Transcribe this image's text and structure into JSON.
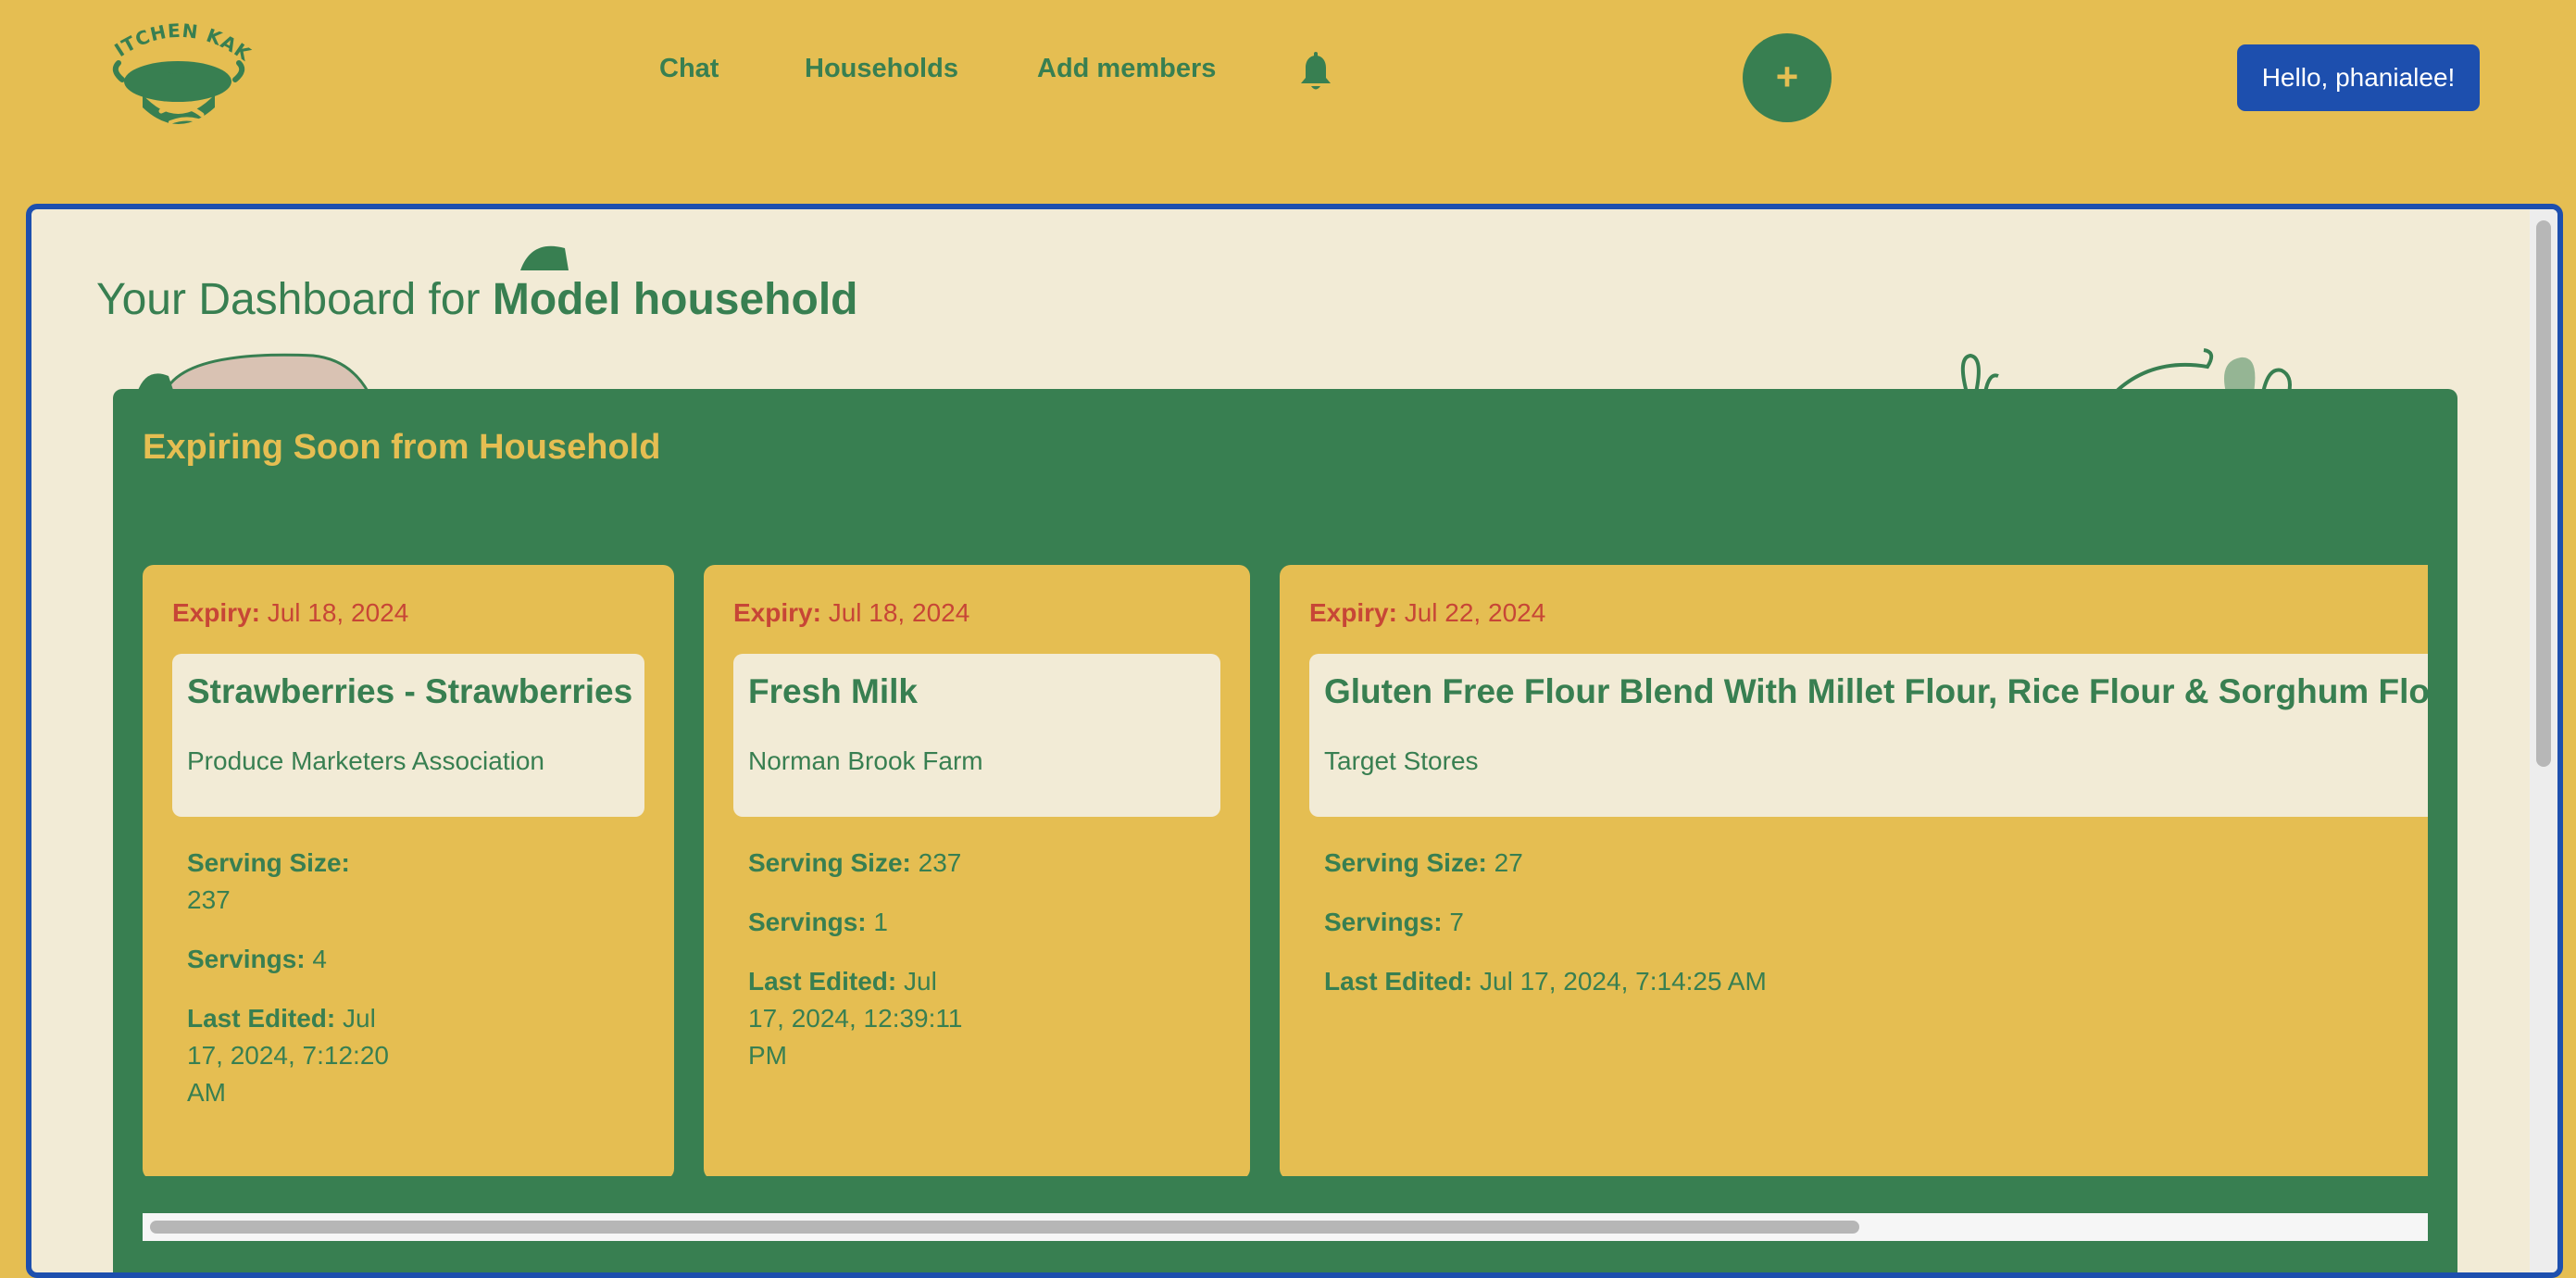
{
  "header": {
    "logo_text": "KITCHEN KAKI",
    "nav": {
      "chat": "Chat",
      "households": "Households",
      "add_members": "Add members"
    },
    "bell_icon": "bell-icon",
    "add_button_label": "+",
    "greeting": "Hello, phanialee!"
  },
  "dashboard": {
    "title_prefix": "Your Dashboard for ",
    "household_name": "Model household"
  },
  "expiring": {
    "title": "Expiring Soon from Household",
    "labels": {
      "expiry": "Expiry:",
      "serving_size": "Serving Size:",
      "servings": "Servings:",
      "last_edited": "Last Edited:"
    },
    "items": [
      {
        "expiry": "Jul 18, 2024",
        "name": "Strawberries - Strawberries",
        "brand": "Produce Marketers Association",
        "serving_size": "237",
        "servings": "4",
        "last_edited": "Jul 17, 2024, 7:12:20 AM"
      },
      {
        "expiry": "Jul 18, 2024",
        "name": "Fresh Milk",
        "brand": "Norman Brook Farm",
        "serving_size": "237",
        "servings": "1",
        "last_edited": "Jul 17, 2024, 12:39:11 PM"
      },
      {
        "expiry": "Jul 22, 2024",
        "name": "Gluten Free Flour Blend With Millet Flour, Rice Flour & Sorghum Flour, Flour",
        "brand": "Target Stores",
        "serving_size": "27",
        "servings": "7",
        "last_edited": "Jul 17, 2024, 7:14:25 AM"
      }
    ]
  },
  "colors": {
    "background": "#E5BE52",
    "brand_green": "#387F51",
    "panel": "#F2EBD6",
    "accent_blue": "#1D4FAE",
    "expiry_red": "#C74636"
  }
}
